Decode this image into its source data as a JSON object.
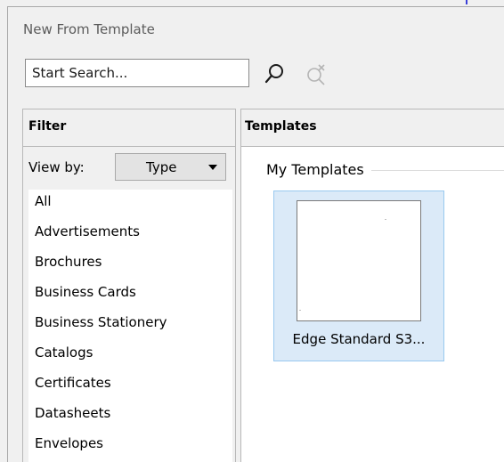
{
  "dialog": {
    "title": "New From Template"
  },
  "search": {
    "value": "",
    "placeholder": "Start Search...",
    "search_icon": "magnifier-icon",
    "clear_icon": "clear-search-icon"
  },
  "filter": {
    "header": "Filter",
    "view_by_label": "View by:",
    "view_by_value": "Type",
    "categories": [
      "All",
      "Advertisements",
      "Brochures",
      "Business Cards",
      "Business Stationery",
      "Catalogs",
      "Certificates",
      "Datasheets",
      "Envelopes"
    ]
  },
  "templates": {
    "header": "Templates",
    "group_title": "My Templates",
    "items": [
      {
        "label": "Edge Standard S3..."
      }
    ]
  },
  "colors": {
    "selection_fill": "#dbeaf8",
    "selection_border": "#99c9ef",
    "panel_bg": "#f0f0f0"
  }
}
